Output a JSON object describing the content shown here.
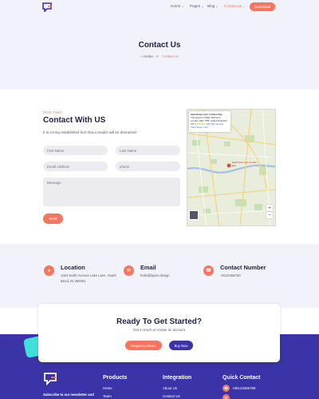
{
  "nav": {
    "logo_icon": "chat-bubble-logo-icon",
    "items": [
      {
        "label": "Home",
        "caret": "⌄"
      },
      {
        "label": "Pages",
        "caret": "⌄"
      },
      {
        "label": "Blog",
        "caret": "⌄"
      },
      {
        "label": "Contact us",
        "caret": "⌄"
      }
    ],
    "download_label": "Download"
  },
  "hero": {
    "title": "Contact Us",
    "breadcrumb_home": "Home",
    "breadcrumb_sep": ">",
    "breadcrumb_current": "Contact us"
  },
  "contact": {
    "kicker": "Get In Touch",
    "title": "Contact With US",
    "subtitle": "It is a long established fact that a reader will be distracted",
    "first_name_placeholder": "First Name",
    "last_name_placeholder": "Last Name",
    "email_placeholder": "Email Address",
    "phone_placeholder": "phone",
    "message_placeholder": "Message",
    "send_label": "Send"
  },
  "map": {
    "place_name": "lastminute.com London Eye",
    "address": "The Queen's Walk, Bishop's, London SE1 7PB, United Kingdom",
    "rating": "4.5",
    "stars": "★★★★★",
    "reviews": "125,761 reviews",
    "larger_map": "View larger map",
    "pin_label": "lastminute.com London Eye",
    "zoom_in": "+",
    "zoom_out": "−"
  },
  "info": {
    "location_title": "Location",
    "location_line1": "1024 North Avenue Lake Lane, South",
    "location_line2": "Bend, IN 360001",
    "email_title": "Email",
    "email_value": "hello@lapnz.design",
    "phone_title": "Contact Number",
    "phone_value": "+0123456780"
  },
  "cta": {
    "title": "Ready To Get Started?",
    "subtitle": "Get in touch or create an account",
    "demo_label": "Request a Demo",
    "buy_label": "Buy Now"
  },
  "footer": {
    "subscribe": "Subscribe to our newsletter and",
    "products_title": "Products",
    "products_items": [
      "Home",
      "Team"
    ],
    "integration_title": "Integration",
    "integration_items": [
      "About Us",
      "Contact Us"
    ],
    "quick_title": "Quick Contact",
    "quick_phone": "+00123456789"
  },
  "colors": {
    "accent": "#f47560",
    "brand": "#3b33a8",
    "hero_bg": "#f2f2fb",
    "teal": "#3ee0d8"
  }
}
